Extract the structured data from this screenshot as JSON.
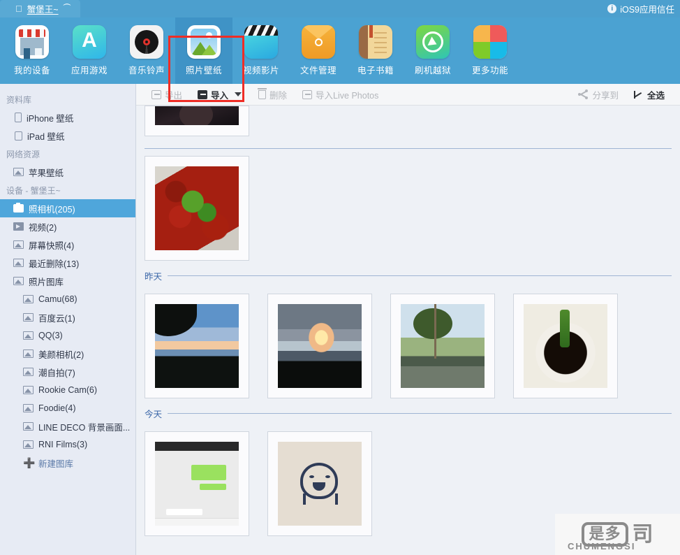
{
  "titlebar": {
    "apple_icon": "apple-logo-icon",
    "device_name": "蟹堡王~",
    "eject_icon": "eject-icon",
    "ios_trust_label": "iOS9应用信任",
    "info_icon": "i"
  },
  "nav": {
    "items": [
      {
        "label": "我的设备",
        "icon": "my-device-icon",
        "active": false
      },
      {
        "label": "应用游戏",
        "icon": "apps-games-icon",
        "active": false
      },
      {
        "label": "音乐铃声",
        "icon": "music-ringtone-icon",
        "active": false
      },
      {
        "label": "照片壁纸",
        "icon": "photos-wallpaper-icon",
        "active": true
      },
      {
        "label": "视频影片",
        "icon": "video-movies-icon",
        "active": false
      },
      {
        "label": "文件管理",
        "icon": "file-manager-icon",
        "active": false
      },
      {
        "label": "电子书籍",
        "icon": "ebooks-icon",
        "active": false
      },
      {
        "label": "刷机越狱",
        "icon": "flash-jailbreak-icon",
        "active": false
      },
      {
        "label": "更多功能",
        "icon": "more-features-icon",
        "active": false
      }
    ],
    "highlight_color": "#ef2d26"
  },
  "toolbar": {
    "export_label": "导出",
    "import_label": "导入",
    "delete_label": "删除",
    "import_live_label": "导入Live Photos",
    "share_label": "分享到",
    "select_all_label": "全选"
  },
  "sidebar": {
    "groups": [
      {
        "title": "资料库",
        "items": [
          {
            "label": "iPhone 壁纸",
            "icon": "iphone-icon",
            "indent": 1,
            "selected": false
          },
          {
            "label": "iPad 壁纸",
            "icon": "ipad-icon",
            "indent": 1,
            "selected": false
          }
        ]
      },
      {
        "title": "网络资源",
        "items": [
          {
            "label": "苹果壁纸",
            "icon": "picture-icon",
            "indent": 1,
            "selected": false
          }
        ]
      },
      {
        "title": "设备 - 蟹堡王~",
        "items": [
          {
            "label": "照相机(205)",
            "icon": "camera-icon",
            "indent": 1,
            "selected": true
          },
          {
            "label": "视频(2)",
            "icon": "film-icon",
            "indent": 1,
            "selected": false
          },
          {
            "label": "屏幕快照(4)",
            "icon": "picture-icon",
            "indent": 1,
            "selected": false
          },
          {
            "label": "最近删除(13)",
            "icon": "picture-icon",
            "indent": 1,
            "selected": false
          },
          {
            "label": "照片图库",
            "icon": "picture-icon",
            "indent": 1,
            "selected": false
          },
          {
            "label": "Camu(68)",
            "icon": "picture-icon",
            "indent": 2,
            "selected": false
          },
          {
            "label": "百度云(1)",
            "icon": "picture-icon",
            "indent": 2,
            "selected": false
          },
          {
            "label": "QQ(3)",
            "icon": "picture-icon",
            "indent": 2,
            "selected": false
          },
          {
            "label": "美颜相机(2)",
            "icon": "picture-icon",
            "indent": 2,
            "selected": false
          },
          {
            "label": "潮自拍(7)",
            "icon": "picture-icon",
            "indent": 2,
            "selected": false
          },
          {
            "label": "Rookie Cam(6)",
            "icon": "picture-icon",
            "indent": 2,
            "selected": false
          },
          {
            "label": "Foodie(4)",
            "icon": "picture-icon",
            "indent": 2,
            "selected": false
          },
          {
            "label": "LINE DECO 背景画面...",
            "icon": "picture-icon",
            "indent": 2,
            "selected": false
          },
          {
            "label": "RNI Films(3)",
            "icon": "picture-icon",
            "indent": 2,
            "selected": false
          }
        ]
      }
    ],
    "new_library_label": "新建图库",
    "new_library_icon": "plus-icon",
    "selected_bg": "#4fa6db"
  },
  "photos": {
    "sections": [
      {
        "label": "",
        "rule_only": true,
        "items": [
          {
            "art": "art-person",
            "alt": "portrait-photo",
            "partial": true
          }
        ]
      },
      {
        "label": "",
        "rule_only": false,
        "no_header": true,
        "items": [
          {
            "art": "art-food",
            "alt": "crayfish-food-photo"
          }
        ]
      },
      {
        "label": "昨天",
        "items": [
          {
            "art": "art-sky1",
            "alt": "sunset-sky-trees-photo"
          },
          {
            "art": "art-sky2",
            "alt": "cloudy-sunset-photo"
          },
          {
            "art": "art-street",
            "alt": "street-trees-photo"
          },
          {
            "art": "art-sauce",
            "alt": "okra-in-sauce-photo"
          }
        ]
      },
      {
        "label": "今天",
        "items": [
          {
            "art": "art-chat",
            "alt": "wechat-screenshot-photo"
          },
          {
            "art": "art-draw",
            "alt": "hand-drawing-photo"
          }
        ]
      }
    ]
  },
  "watermark": {
    "box_text": "是多",
    "side_text": "司",
    "caption": "CHUMENGSI"
  }
}
